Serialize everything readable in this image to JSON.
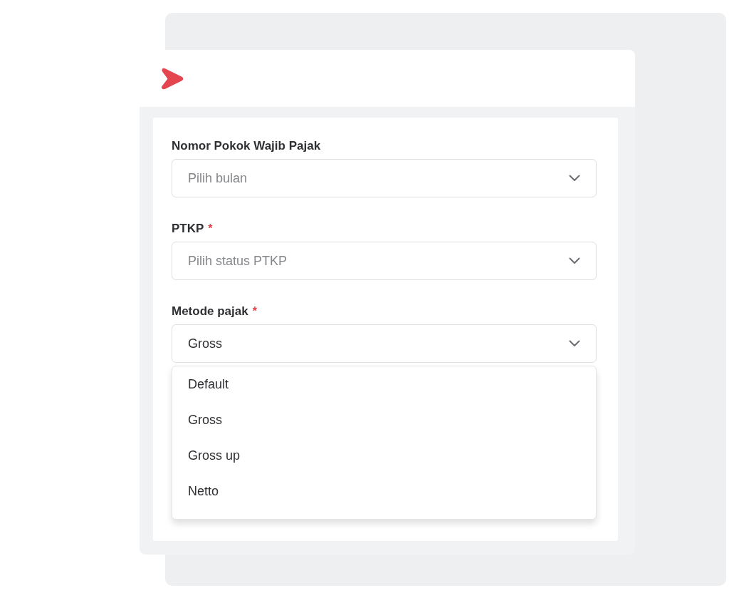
{
  "fields": [
    {
      "label": "Nomor Pokok Wajib Pajak",
      "placeholder": "Pilih bulan"
    },
    {
      "label": "PTKP",
      "required_mark": "*",
      "placeholder": "Pilih status PTKP"
    },
    {
      "label": "Metode pajak",
      "required_mark": "*",
      "value": "Gross",
      "expanded": true,
      "options": [
        "Default",
        "Gross",
        "Gross up",
        "Netto"
      ]
    }
  ]
}
